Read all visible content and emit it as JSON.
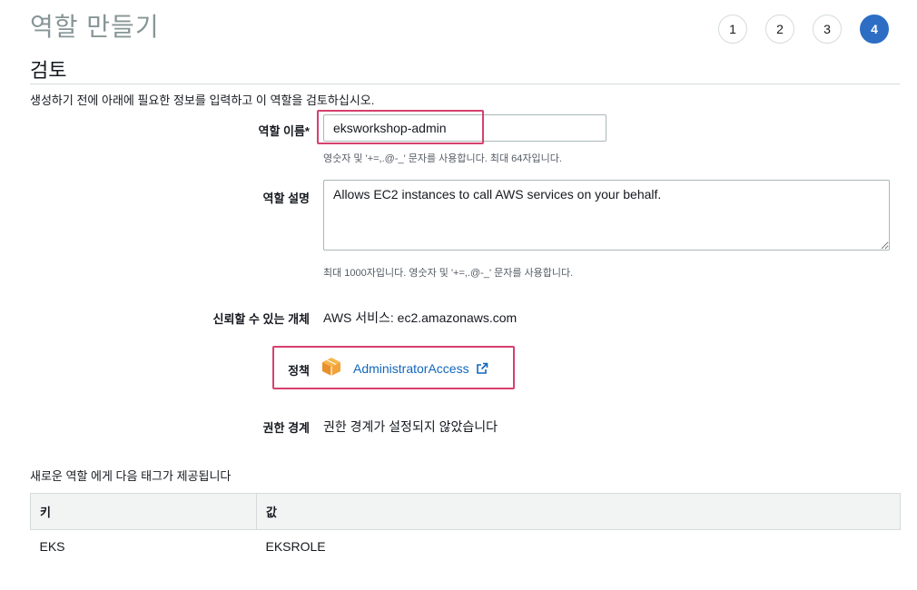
{
  "page_title": "역할 만들기",
  "steps": [
    "1",
    "2",
    "3",
    "4"
  ],
  "active_step": "4",
  "section_title": "검토",
  "intro_text": "생성하기 전에 아래에 필요한 정보를 입력하고 이 역할을 검토하십시오.",
  "role_name": {
    "label": "역할 이름*",
    "value": "eksworkshop-admin",
    "hint": "영숫자 및 '+=,.@-_' 문자를 사용합니다. 최대 64자입니다."
  },
  "role_description": {
    "label": "역할 설명",
    "value": "Allows EC2 instances to call AWS services on your behalf.",
    "hint": "최대 1000자입니다. 영숫자 및 '+=,.@-_' 문자를 사용합니다."
  },
  "trusted_entity": {
    "label": "신뢰할 수 있는 개체",
    "value": "AWS 서비스: ec2.amazonaws.com"
  },
  "policy": {
    "label": "정책",
    "link_text": "AdministratorAccess"
  },
  "permissions_boundary": {
    "label": "권한 경계",
    "value": "권한 경계가 설정되지 않았습니다"
  },
  "tags": {
    "caption": "새로운 역할 에게 다음 태그가 제공됩니다",
    "headers": [
      "키",
      "값"
    ],
    "rows": [
      [
        "EKS",
        "EKSROLE"
      ]
    ]
  },
  "colors": {
    "accent_blue": "#2d6ec4",
    "link_blue": "#1066bb",
    "highlight_pink": "#d6406e",
    "policy_icon_orange": "#f2a33a"
  }
}
